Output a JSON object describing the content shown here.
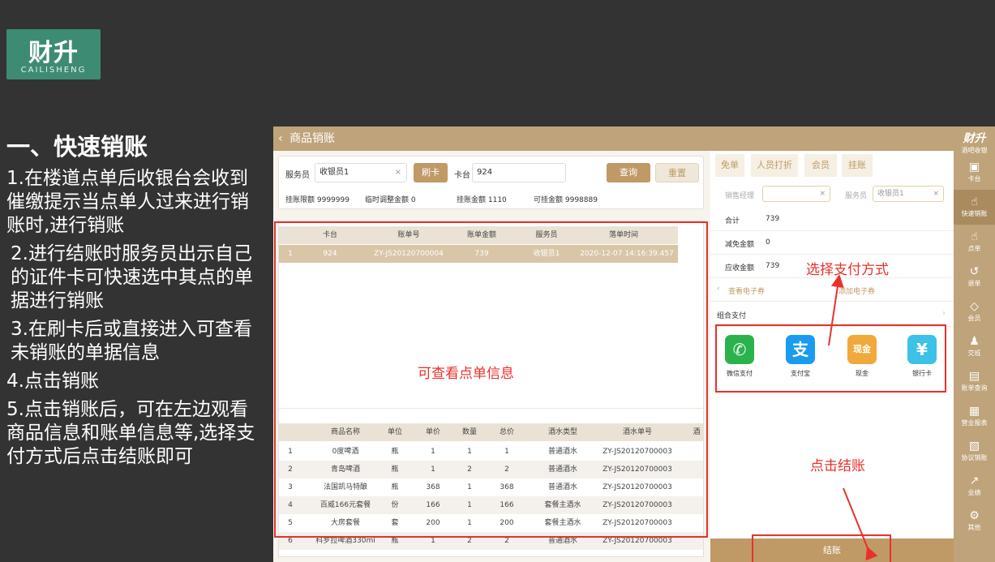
{
  "logo": {
    "main": "财升",
    "sub": "CAILISHENG"
  },
  "slide": {
    "title": "一、快速销账",
    "steps": [
      "1.在楼道点单后收银台会收到催缴提示当点单人过来进行销账时,进行销账",
      "2.进行结账时服务员出示自己的证件卡可快速选中其点的单据进行销账",
      "3.在刷卡后或直接进入可查看未销账的单据信息",
      "4.点击销账",
      "5.点击销账后，可在左边观看商品信息和账单信息等,选择支付方式后点击结账即可"
    ]
  },
  "app": {
    "header": {
      "back_icon": "‹",
      "title": "商品销账"
    },
    "sidebar": {
      "brand": "财升",
      "brand_sub": "酒吧收银",
      "items": [
        {
          "label": "卡台",
          "icon": "▣"
        },
        {
          "label": "快速销账",
          "icon": "☝"
        },
        {
          "label": "点单",
          "icon": "☝"
        },
        {
          "label": "退单",
          "icon": "↺"
        },
        {
          "label": "会员",
          "icon": "◇"
        },
        {
          "label": "交班",
          "icon": "♟"
        },
        {
          "label": "账单查询",
          "icon": "▤"
        },
        {
          "label": "营业报表",
          "icon": "▦"
        },
        {
          "label": "协议销账",
          "icon": "▧"
        },
        {
          "label": "业绩",
          "icon": "↗"
        },
        {
          "label": "其他",
          "icon": "⚙"
        }
      ]
    },
    "filter": {
      "waiter_label": "服务员",
      "waiter_value": "收银员1",
      "clear_icon": "×",
      "swipe_button": "刷卡",
      "table_label": "卡台",
      "table_value": "924",
      "query_button": "查询",
      "reset_button": "重置",
      "credit_limit": "挂账限额  9999999",
      "temp_adjust": "临时调整金额  0",
      "credit_amount": "挂账金额  1110",
      "available": "可挂金额  9998889"
    },
    "bills": {
      "headers": [
        "卡台",
        "账单号",
        "账单金额",
        "服务员",
        "落单时间"
      ],
      "rows": [
        {
          "no": "1",
          "table": "924",
          "bill": "ZY-JS20120700004",
          "amount": "739",
          "waiter": "收银员1",
          "time": "2020-12-07 14:16:39.457"
        }
      ]
    },
    "items": {
      "headers": [
        "商品名称",
        "单位",
        "单价",
        "数量",
        "总价",
        "酒水类型",
        "酒水单号",
        "酒"
      ],
      "rows": [
        {
          "no": "1",
          "name": "0度啤酒",
          "unit": "瓶",
          "price": "1",
          "qty": "1",
          "total": "1",
          "type": "普通酒水",
          "order": "ZY-JS20120700003"
        },
        {
          "no": "2",
          "name": "青岛啤酒",
          "unit": "瓶",
          "price": "1",
          "qty": "2",
          "total": "2",
          "type": "普通酒水",
          "order": "ZY-JS20120700003"
        },
        {
          "no": "3",
          "name": "法国凯马特酿",
          "unit": "瓶",
          "price": "368",
          "qty": "1",
          "total": "368",
          "type": "普通酒水",
          "order": "ZY-JS20120700003"
        },
        {
          "no": "4",
          "name": "百威166元套餐",
          "unit": "份",
          "price": "166",
          "qty": "1",
          "total": "166",
          "type": "套餐主酒水",
          "order": "ZY-JS20120700003"
        },
        {
          "no": "5",
          "name": "大房套餐",
          "unit": "套",
          "price": "200",
          "qty": "1",
          "total": "200",
          "type": "套餐主酒水",
          "order": "ZY-JS20120700003"
        },
        {
          "no": "6",
          "name": "科罗拉啤酒330ml",
          "unit": "瓶",
          "price": "1",
          "qty": "2",
          "total": "2",
          "type": "普通酒水",
          "order": "ZY-JS20120700003"
        }
      ]
    },
    "right": {
      "tabs": [
        "免单",
        "人员打折",
        "会员",
        "挂账"
      ],
      "sales_manager_label": "销售经理",
      "waiter_label": "服务员",
      "waiter_value": "收银员1",
      "clear_icon": "×",
      "total_label": "合计",
      "total_value": "739",
      "discount_label": "减免金额",
      "discount_value": "0",
      "due_label": "应收金额",
      "due_value": "739",
      "coupon_view": "查看电子券",
      "coupon_add": "添加电子券",
      "back_icon": "‹",
      "chevron_icon": "›",
      "combo_label": "组合支付",
      "payments": [
        {
          "label": "微信支付",
          "glyph": "✆",
          "color": "#2bb24c"
        },
        {
          "label": "支付宝",
          "glyph": "支",
          "color": "#1a9bf0"
        },
        {
          "label": "现金",
          "glyph": "现金",
          "color": "#f0a93b"
        },
        {
          "label": "银行卡",
          "glyph": "¥",
          "color": "#3cc1e8"
        }
      ],
      "checkout_button": "结账"
    }
  },
  "annotations": {
    "order_info": "可查看点单信息",
    "choose_payment": "选择支付方式",
    "click_checkout": "点击结账",
    "colors": {
      "red": "#e8312b",
      "gold": "#bf9a66"
    }
  }
}
